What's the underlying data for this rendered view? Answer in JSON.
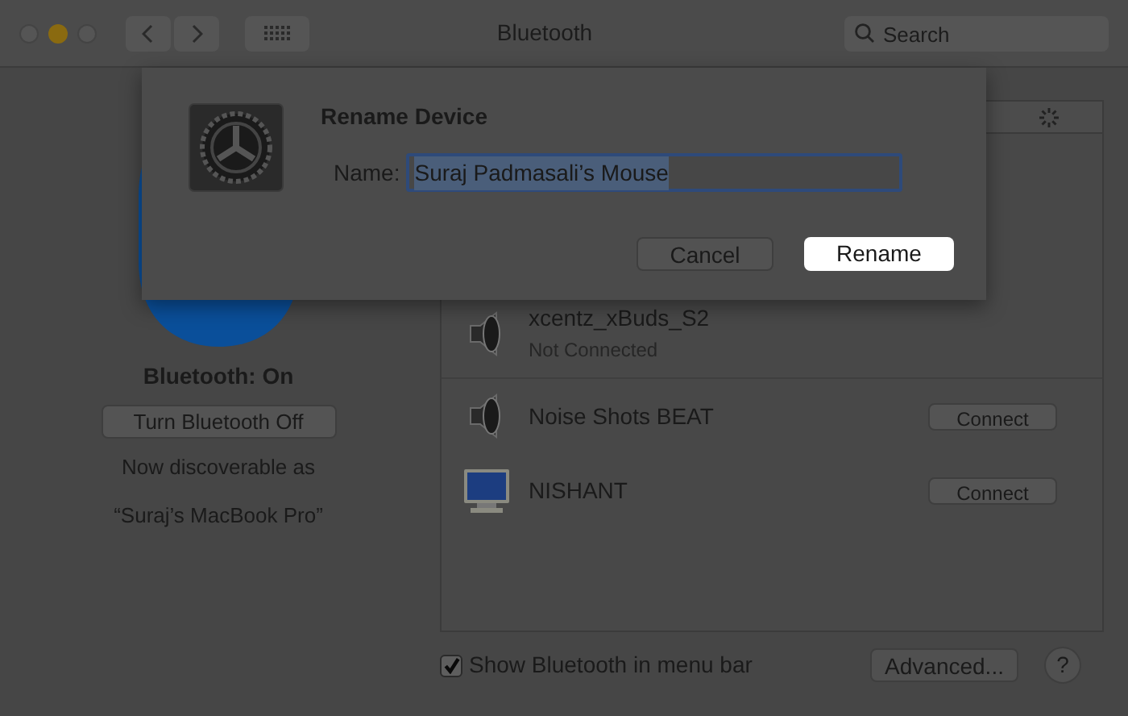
{
  "window": {
    "title": "Bluetooth"
  },
  "search": {
    "placeholder": "Search"
  },
  "sidebar": {
    "status": "Bluetooth: On",
    "toggle_button": "Turn Bluetooth Off",
    "discoverable_label": "Now discoverable as",
    "device_name": "“Suraj’s MacBook Pro”"
  },
  "devices": [
    {
      "name": "xcentz_xBuds_S2",
      "status": "Not Connected",
      "kind": "speaker"
    },
    {
      "name": "Noise Shots BEAT",
      "action": "Connect",
      "kind": "speaker"
    },
    {
      "name": "NISHANT",
      "action": "Connect",
      "kind": "monitor"
    }
  ],
  "show_in_menu_bar": {
    "label": "Show Bluetooth in menu bar",
    "checked": true
  },
  "advanced_button": "Advanced...",
  "help_button": "?",
  "dialog": {
    "title": "Rename Device",
    "field_label": "Name:",
    "value": "Suraj Padmasali’s Mouse",
    "buttons": [
      {
        "label": "Cancel",
        "default": false
      },
      {
        "label": "Rename",
        "default": true
      }
    ]
  }
}
